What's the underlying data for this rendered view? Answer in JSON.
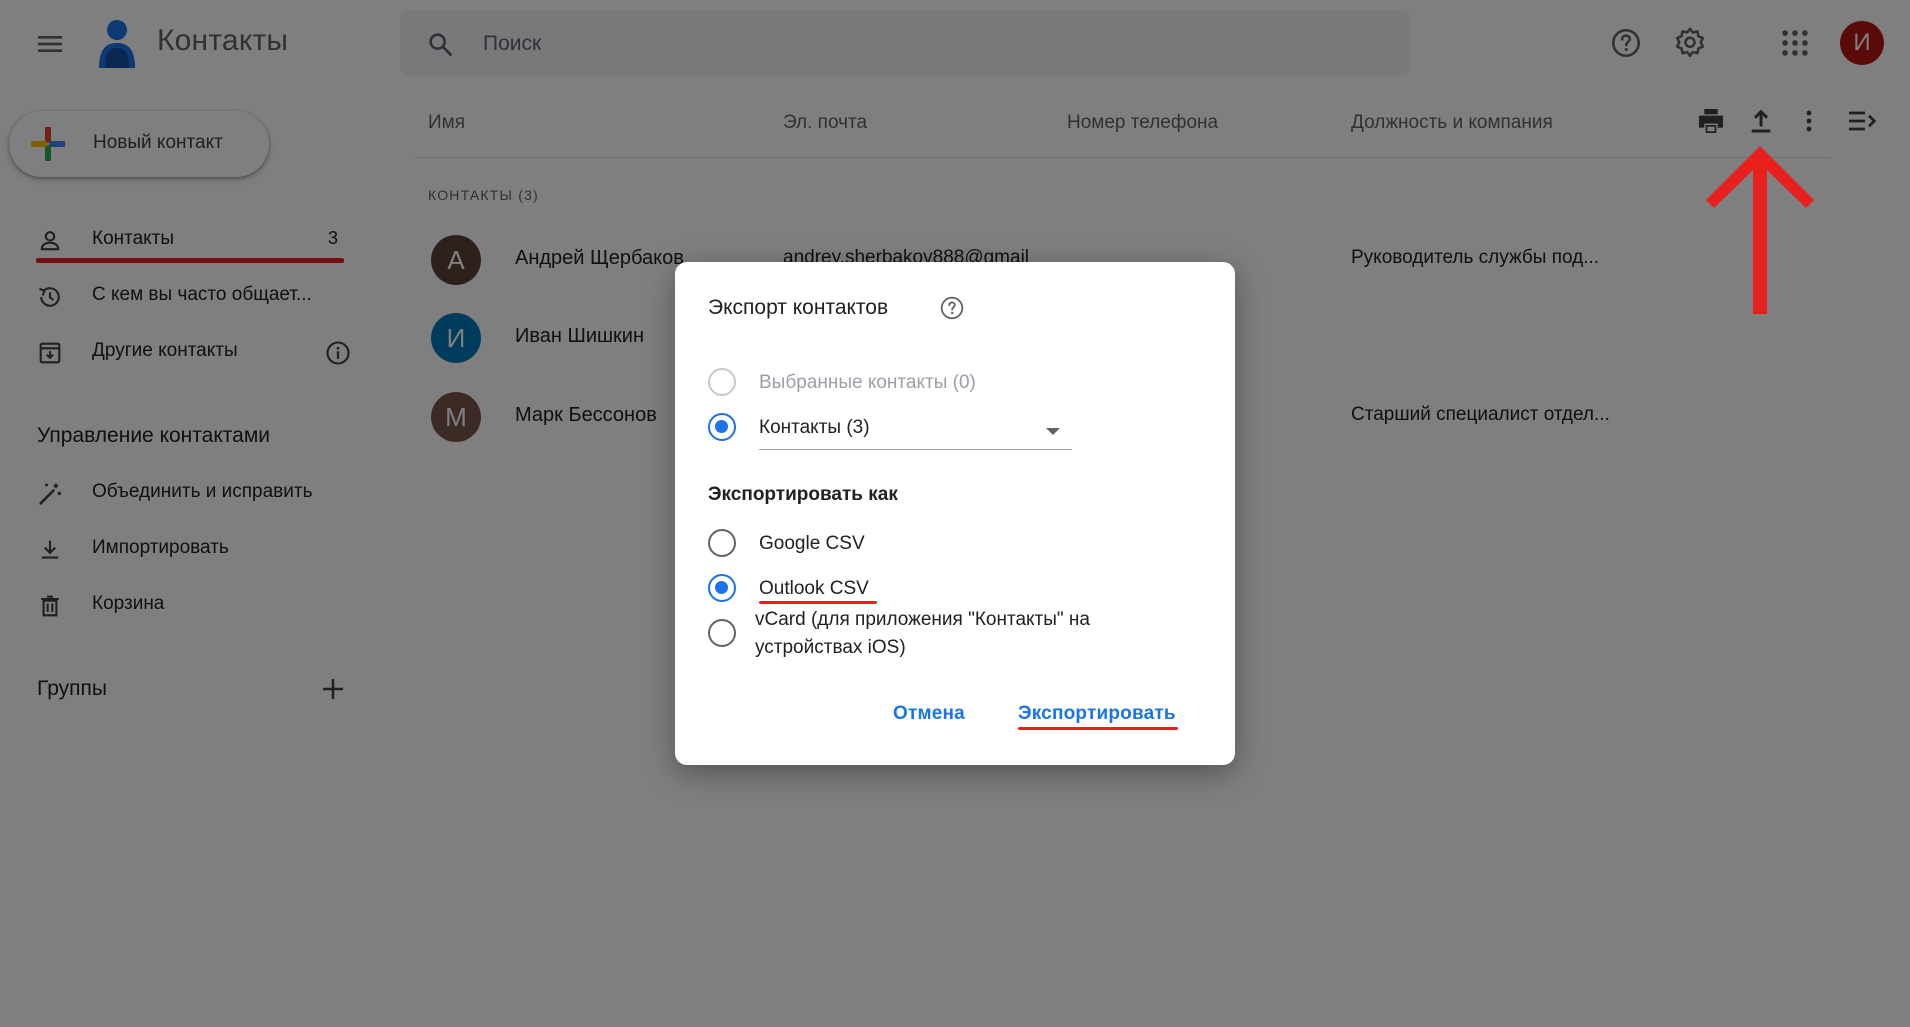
{
  "app": {
    "title": "Контакты"
  },
  "search": {
    "placeholder": "Поиск"
  },
  "header": {
    "icons": [
      "help-icon",
      "settings-icon",
      "apps-icon"
    ],
    "account_initial": "И",
    "account_color": "#b31412"
  },
  "sidebar": {
    "new_contact_label": "Новый контакт",
    "items": [
      {
        "label": "Контакты",
        "count": "3",
        "icon": "person-icon"
      },
      {
        "label": "С кем вы часто общает...",
        "icon": "history-icon"
      },
      {
        "label": "Другие контакты",
        "icon": "archive-icon",
        "info_icon": "info-icon"
      }
    ],
    "manage_title": "Управление контактами",
    "manage_items": [
      {
        "label": "Объединить и исправить",
        "icon": "magic-wand-icon"
      },
      {
        "label": "Импортировать",
        "icon": "download-icon"
      },
      {
        "label": "Корзина",
        "icon": "trash-icon"
      }
    ],
    "groups_title": "Группы"
  },
  "list": {
    "columns": [
      "Имя",
      "Эл. почта",
      "Номер телефона",
      "Должность и компания"
    ],
    "toolbar_icons": [
      "print-icon",
      "export-icon",
      "more-vert-icon",
      "collapse-list-icon"
    ],
    "caption": "КОНТАКТЫ (3)",
    "contacts": [
      {
        "initial": "А",
        "color": "#5d4037",
        "name": "Андрей Щербаков",
        "email": "andrey.sherbakov888@gmail",
        "job": "Руководитель службы под..."
      },
      {
        "initial": "И",
        "color": "#0277bd",
        "name": "Иван Шишкин",
        "email": "",
        "job": ""
      },
      {
        "initial": "М",
        "color": "#795548",
        "name": "Марк Бессонов",
        "email": "",
        "job": "Старший специалист отдел..."
      }
    ]
  },
  "dialog": {
    "title": "Экспорт контактов",
    "scope_options": [
      {
        "label": "Выбранные контакты (0)",
        "checked": false,
        "disabled": true
      },
      {
        "label": "Контакты (3)",
        "checked": true,
        "disabled": false
      }
    ],
    "format_title": "Экспортировать как",
    "format_options": [
      {
        "label": "Google CSV",
        "checked": false
      },
      {
        "label": "Outlook CSV",
        "checked": true
      },
      {
        "label": "vCard (для приложения \"Контакты\" на устройствах iOS)",
        "checked": false
      }
    ],
    "cancel_label": "Отмена",
    "export_label": "Экспортировать"
  },
  "colors": {
    "accent": "#1a73e8",
    "annotation": "#e8201e",
    "scrim": "rgba(0,0,0,0.5)"
  }
}
